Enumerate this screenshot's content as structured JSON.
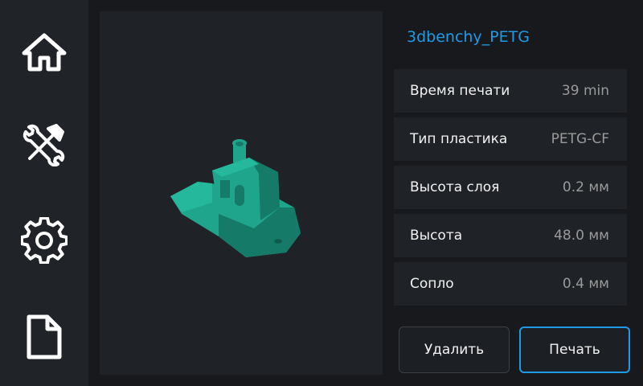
{
  "sidebar": {
    "items": [
      {
        "icon": "home-icon",
        "name": "home"
      },
      {
        "icon": "tools-icon",
        "name": "tools"
      },
      {
        "icon": "gear-icon",
        "name": "settings"
      },
      {
        "icon": "file-icon",
        "name": "files"
      }
    ]
  },
  "file": {
    "name": "3dbenchy_PETG",
    "title_color": "#1e9be4",
    "model_color": "#1fa58c"
  },
  "properties": [
    {
      "label": "Время печати",
      "value": "39 min"
    },
    {
      "label": "Тип пластика",
      "value": "PETG-CF"
    },
    {
      "label": "Высота слоя",
      "value": "0.2 мм"
    },
    {
      "label": "Высота",
      "value": "48.0 мм"
    },
    {
      "label": "Сопло",
      "value": "0.4 мм"
    }
  ],
  "actions": {
    "delete_label": "Удалить",
    "print_label": "Печать",
    "accent_color": "#1f9be6"
  }
}
